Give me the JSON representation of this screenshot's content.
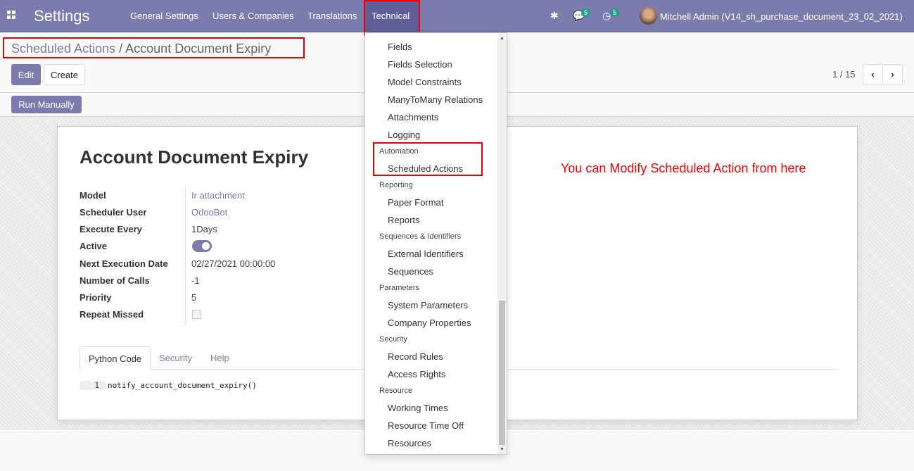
{
  "nav": {
    "brand": "Settings",
    "menus": [
      "General Settings",
      "Users & Companies",
      "Translations",
      "Technical"
    ],
    "messages_count": "5",
    "activities_count": "5",
    "user": "Mitchell Admin (V14_sh_purchase_document_23_02_2021)"
  },
  "breadcrumb": {
    "parent": "Scheduled Actions",
    "separator": "/",
    "current": "Account Document Expiry"
  },
  "toolbar": {
    "edit": "Edit",
    "create": "Create",
    "run": "Run Manually",
    "pager": "1 / 15"
  },
  "form": {
    "title": "Account Document Expiry",
    "fields": [
      {
        "label": "Model",
        "value": "Ir attachment"
      },
      {
        "label": "Scheduler User",
        "value": "OdooBot"
      },
      {
        "label": "Execute Every",
        "value": "1Days"
      },
      {
        "label": "Active",
        "value": true
      },
      {
        "label": "Next Execution Date",
        "value": "02/27/2021 00:00:00"
      },
      {
        "label": "Number of Calls",
        "value": "-1"
      },
      {
        "label": "Priority",
        "value": "5"
      },
      {
        "label": "Repeat Missed",
        "value": false
      }
    ],
    "tabs": [
      "Python Code",
      "Security",
      "Help"
    ],
    "code_line": "1",
    "code": "notify_account_document_expiry()"
  },
  "dropdown": {
    "items": [
      "Fields",
      "Fields Selection",
      "Model Constraints",
      "ManyToMany Relations",
      "Attachments",
      "Logging"
    ],
    "automation": {
      "header": "Automation",
      "items": [
        "Scheduled Actions"
      ]
    },
    "reporting": {
      "header": "Reporting",
      "items": [
        "Paper Format",
        "Reports"
      ]
    },
    "sequences": {
      "header": "Sequences & Identifiers",
      "items": [
        "External Identifiers",
        "Sequences"
      ]
    },
    "parameters": {
      "header": "Parameters",
      "items": [
        "System Parameters",
        "Company Properties"
      ]
    },
    "security": {
      "header": "Security",
      "items": [
        "Record Rules",
        "Access Rights"
      ]
    },
    "resource": {
      "header": "Resource",
      "items": [
        "Working Times",
        "Resource Time Off",
        "Resources"
      ]
    }
  },
  "annotation": "You can Modify Scheduled Action from here",
  "colors": {
    "brand": "#7c7bad",
    "annotation": "#ff0000"
  }
}
